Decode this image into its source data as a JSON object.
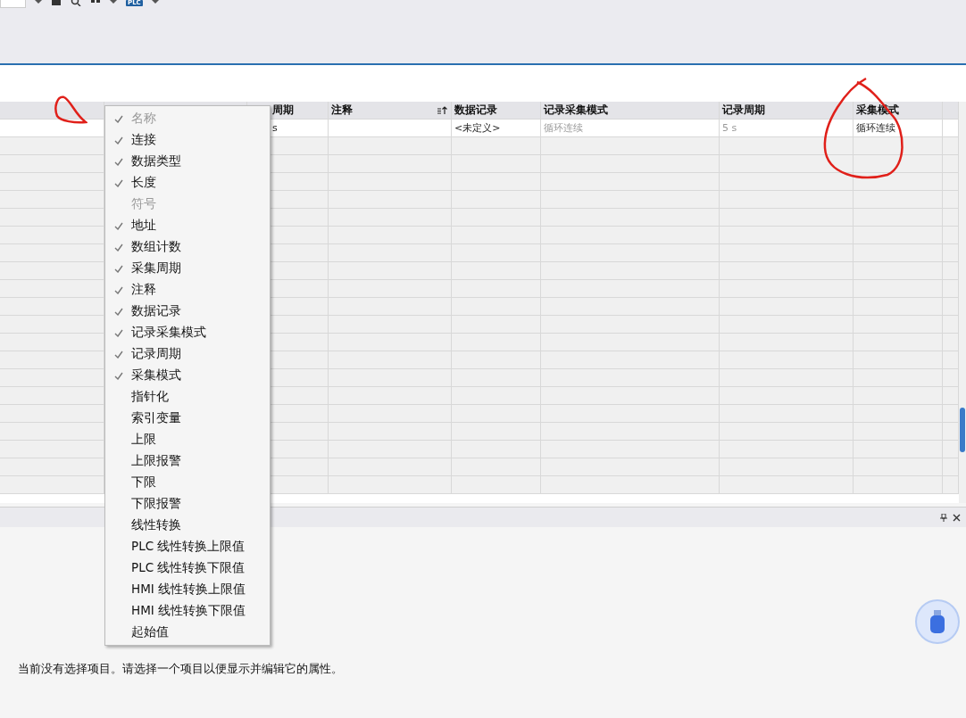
{
  "toolbar": {
    "plc_badge": "PLC"
  },
  "table": {
    "columns": [
      {
        "label": "周期",
        "sorted": false
      },
      {
        "label": "注释",
        "sorted": true
      },
      {
        "label": "数据记录",
        "sorted": false
      },
      {
        "label": "记录采集模式",
        "sorted": false
      },
      {
        "label": "记录周期",
        "sorted": false
      },
      {
        "label": "采集模式",
        "sorted": false
      }
    ],
    "rows": [
      {
        "cells": [
          {
            "text": "s",
            "dimmed": false
          },
          null,
          {
            "text": "<未定义>",
            "dimmed": false
          },
          {
            "text": "循环连续",
            "dimmed": true
          },
          {
            "text": "5 s",
            "dimmed": true
          },
          {
            "text": "循环连续",
            "dimmed": false
          }
        ]
      }
    ]
  },
  "context_menu": {
    "items": [
      {
        "label": "名称",
        "checked": true,
        "disabled": true
      },
      {
        "label": "连接",
        "checked": true,
        "disabled": false
      },
      {
        "label": "数据类型",
        "checked": true,
        "disabled": false
      },
      {
        "label": "长度",
        "checked": true,
        "disabled": false
      },
      {
        "label": "符号",
        "checked": false,
        "disabled": true
      },
      {
        "label": "地址",
        "checked": true,
        "disabled": false
      },
      {
        "label": "数组计数",
        "checked": true,
        "disabled": false
      },
      {
        "label": "采集周期",
        "checked": true,
        "disabled": false
      },
      {
        "label": "注释",
        "checked": true,
        "disabled": false
      },
      {
        "label": "数据记录",
        "checked": true,
        "disabled": false
      },
      {
        "label": "记录采集模式",
        "checked": true,
        "disabled": false
      },
      {
        "label": "记录周期",
        "checked": true,
        "disabled": false
      },
      {
        "label": "采集模式",
        "checked": true,
        "disabled": false
      },
      {
        "label": "指针化",
        "checked": false,
        "disabled": false
      },
      {
        "label": "索引变量",
        "checked": false,
        "disabled": false
      },
      {
        "label": "上限",
        "checked": false,
        "disabled": false
      },
      {
        "label": "上限报警",
        "checked": false,
        "disabled": false
      },
      {
        "label": "下限",
        "checked": false,
        "disabled": false
      },
      {
        "label": "下限报警",
        "checked": false,
        "disabled": false
      },
      {
        "label": "线性转换",
        "checked": false,
        "disabled": false
      },
      {
        "label": "PLC 线性转换上限值",
        "checked": false,
        "disabled": false
      },
      {
        "label": "PLC 线性转换下限值",
        "checked": false,
        "disabled": false
      },
      {
        "label": "HMI 线性转换上限值",
        "checked": false,
        "disabled": false
      },
      {
        "label": "HMI 线性转换下限值",
        "checked": false,
        "disabled": false
      },
      {
        "label": "起始值",
        "checked": false,
        "disabled": false
      }
    ]
  },
  "properties": {
    "message": "当前没有选择项目。请选择一个项目以便显示并编辑它的属性。"
  }
}
